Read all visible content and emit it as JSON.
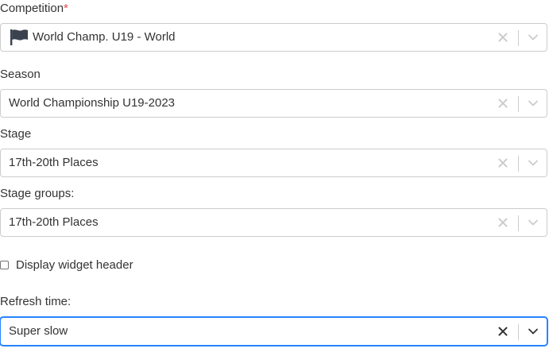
{
  "form": {
    "competition": {
      "label": "Competition",
      "required_mark": "*",
      "value": "World Champ. U19 - World",
      "icon": "flag-icon"
    },
    "season": {
      "label": "Season",
      "value": "World Championship U19-2023"
    },
    "stage": {
      "label": "Stage",
      "value": "17th-20th Places"
    },
    "stage_groups": {
      "label": "Stage groups:",
      "value": "17th-20th Places"
    },
    "display_header": {
      "label": "Display widget header",
      "checked": false
    },
    "refresh_time": {
      "label": "Refresh time:",
      "value": "Super slow"
    }
  },
  "colors": {
    "required": "#e04a4a",
    "focus_border": "#2684ff",
    "border": "#cccccc",
    "indicator": "#cccccc",
    "indicator_focused": "#333333"
  }
}
